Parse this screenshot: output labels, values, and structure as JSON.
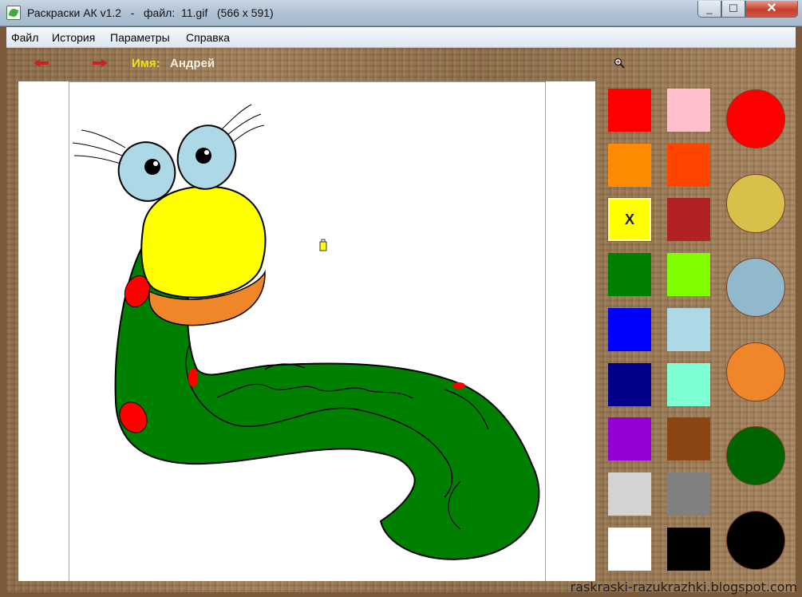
{
  "window": {
    "title": "Раскраски АК v1.2   -   файл:  11.gif   (566 x 591)",
    "close_glyph": "✕",
    "max_glyph": "☐",
    "min_glyph": "_"
  },
  "menu": [
    "Файл",
    "История",
    "Параметры",
    "Справка"
  ],
  "toolbar": {
    "name_label": "Имя:",
    "name_value": "Андрей"
  },
  "palette": {
    "selected_mark": "X",
    "swatches": [
      {
        "color": "#ff0000"
      },
      {
        "color": "#ffc0cb"
      },
      {
        "color": "#ff8c00"
      },
      {
        "color": "#ff4500"
      },
      {
        "color": "#ffff00",
        "selected": true
      },
      {
        "color": "#b22222"
      },
      {
        "color": "#008000"
      },
      {
        "color": "#7fff00"
      },
      {
        "color": "#0000ff"
      },
      {
        "color": "#add8e6"
      },
      {
        "color": "#00008b"
      },
      {
        "color": "#7fffd4"
      },
      {
        "color": "#9400d3"
      },
      {
        "color": "#8b4513"
      },
      {
        "color": "#d3d3d3"
      },
      {
        "color": "#808080"
      },
      {
        "color": "#ffffff"
      },
      {
        "color": "#000000"
      }
    ],
    "used_colors": [
      "#ff0000",
      "#d9c04a",
      "#92b8cc",
      "#f0862a",
      "#006400",
      "#000000"
    ]
  },
  "icons": {
    "back": "arrow-left-icon",
    "forward": "arrow-right-icon",
    "zoom": "magnifier-icon",
    "cursor": "paint-bucket-icon"
  },
  "watermark": "raskraski-razukrazhki.blogspot.com"
}
